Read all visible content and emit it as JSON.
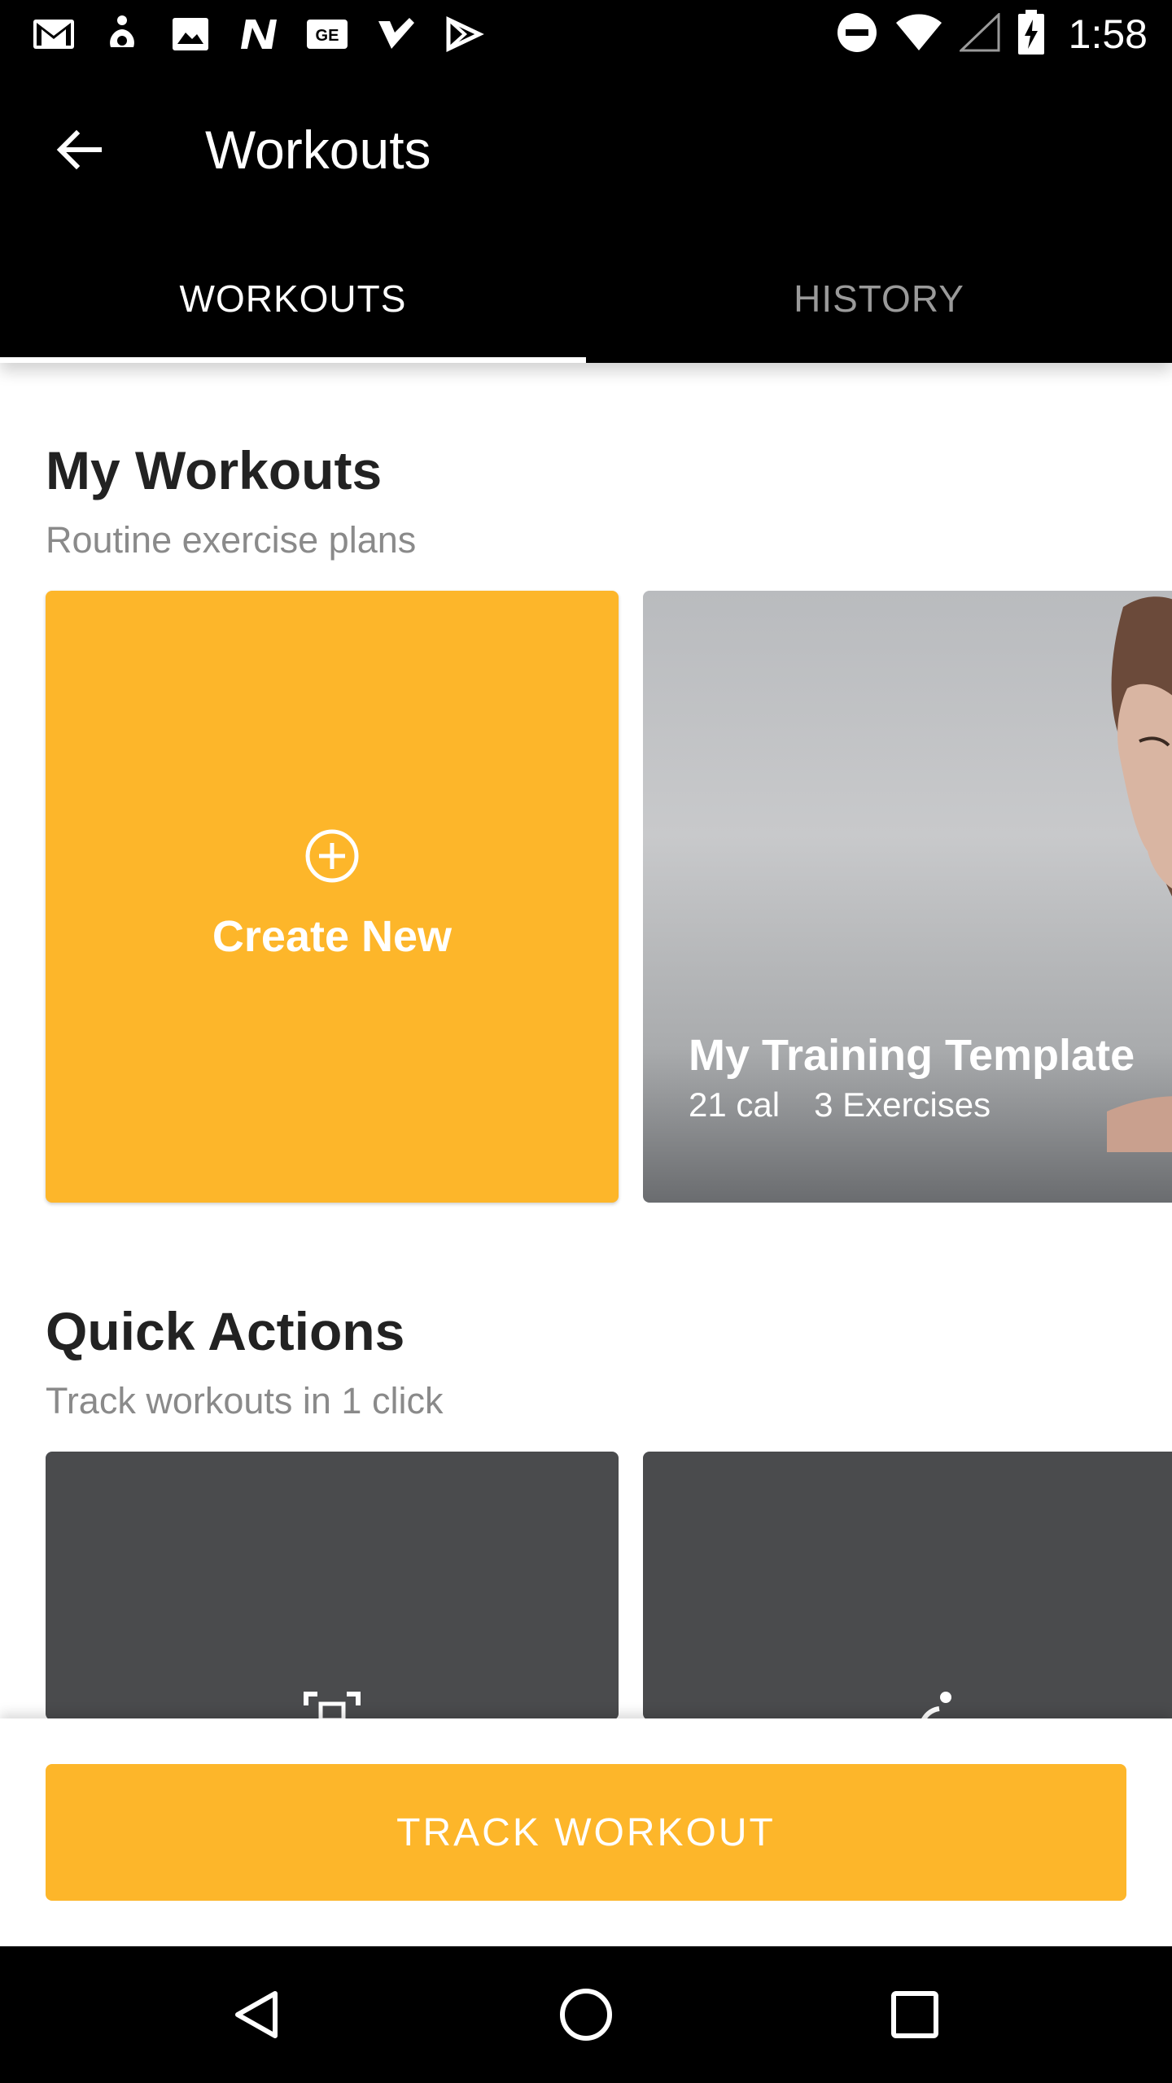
{
  "status_bar": {
    "time": "1:58",
    "left_icons": [
      "gmail-icon",
      "accessibility-icon",
      "image-icon",
      "n-icon",
      "ge-icon",
      "check-icon",
      "play-store-icon"
    ],
    "right_icons": [
      "do-not-disturb-icon",
      "wifi-icon",
      "signal-icon",
      "battery-charging-icon"
    ]
  },
  "app_bar": {
    "title": "Workouts",
    "back_icon": "back-arrow-icon"
  },
  "tabs": [
    {
      "label": "WORKOUTS",
      "active": true
    },
    {
      "label": "HISTORY",
      "active": false
    }
  ],
  "my_workouts": {
    "title": "My Workouts",
    "subtitle": "Routine exercise plans",
    "create_card": {
      "label": "Create New",
      "icon": "add-circle-icon"
    },
    "template_card": {
      "title": "My Training Template",
      "calories": "21 cal",
      "exercises": "3 Exercises"
    }
  },
  "quick_actions": {
    "title": "Quick Actions",
    "subtitle": "Track workouts in 1 click",
    "cards": [
      {
        "icon": "scan-icon"
      },
      {
        "icon": "person-workout-icon"
      }
    ]
  },
  "track_button": {
    "label": "TRACK WORKOUT"
  },
  "nav_bar": {
    "icons": [
      "back-triangle-icon",
      "home-circle-icon",
      "recents-square-icon"
    ]
  },
  "colors": {
    "accent": "#fdb62a",
    "bar_bg": "#000000",
    "card_dark": "#4a4b4d"
  }
}
